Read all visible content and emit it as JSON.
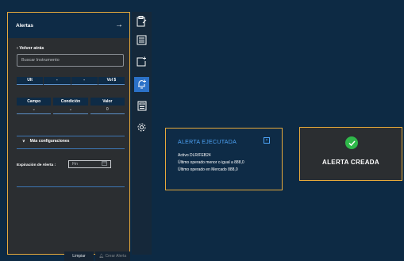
{
  "panel": {
    "title": "Alertas",
    "back_label": "Volver atrás",
    "search_placeholder": "Buscar Instrumento",
    "quote_headers": [
      "Ult",
      "-",
      "-",
      "Vol $"
    ],
    "filter_headers": [
      "Campo",
      "Condición",
      "Valor"
    ],
    "filter_values": [
      "",
      "",
      "0"
    ],
    "more_config_label": "Más configuraciones",
    "expiration_label": "Expiración de Alerta :",
    "expiration_placeholder": "Fin",
    "clean_label": "Limpiar",
    "create_label": "Crear Alerta"
  },
  "rail": {
    "items": [
      "clipboard-icon",
      "list-icon",
      "add-box-icon",
      "bell-add-icon",
      "calculator-icon",
      "gear-icon"
    ]
  },
  "toast": {
    "title": "ALERTA EJECUTADA",
    "lines": [
      "Activo DLR/FEB24",
      "Último operado menor o igual a 888,0",
      "Último operado en Mercado 888,0"
    ]
  },
  "success": {
    "text": "ALERTA CREADA"
  },
  "colors": {
    "background": "#0d2a44",
    "panel": "#2b2e31",
    "accent_border": "#e6a93b",
    "active_rail": "#2b71c8",
    "success_green": "#2fb84a",
    "toast_title": "#4da3f5"
  }
}
